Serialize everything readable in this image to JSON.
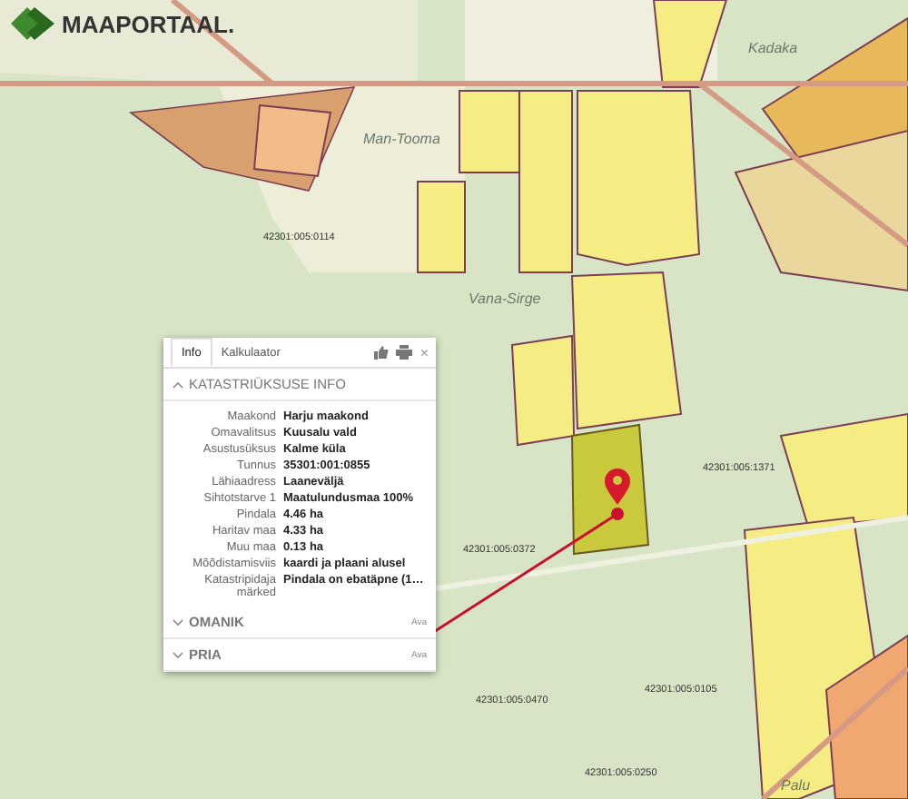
{
  "logo": {
    "text": "MAAPORTAAL."
  },
  "map": {
    "labels": [
      {
        "kind": "place",
        "text": "Kadaka"
      },
      {
        "kind": "place",
        "text": "Vana-Sirge"
      },
      {
        "kind": "place",
        "text": "Man-Tooma"
      },
      {
        "kind": "place",
        "text": "Palu"
      },
      {
        "kind": "parcel",
        "text": "42301:005:0470"
      },
      {
        "kind": "parcel",
        "text": "42301:005:0105"
      },
      {
        "kind": "parcel",
        "text": "42301:005:1371"
      },
      {
        "kind": "parcel",
        "text": "42301:005:0114"
      },
      {
        "kind": "parcel",
        "text": "42301:005:0250"
      },
      {
        "kind": "parcel",
        "text": "42301:005:0372"
      }
    ]
  },
  "popup": {
    "close": "×",
    "tabs": [
      {
        "label": "Info",
        "selected": true
      },
      {
        "label": "Kalkulaator",
        "selected": false
      }
    ],
    "sections": [
      {
        "title": "KATASTRIÜKSUSE INFO",
        "expanded": true,
        "rows": [
          {
            "label": "Maakond",
            "value": "Harju maakond"
          },
          {
            "label": "Omavalitsus",
            "value": "Kuusalu vald"
          },
          {
            "label": "Asustusüksus",
            "value": "Kalme küla"
          },
          {
            "label": "Tunnus",
            "value": "35301:001:0855"
          },
          {
            "label": "Lähiaadress",
            "value": "Laaneväljä"
          },
          {
            "label": "Sihtotstarve 1",
            "value": "Maatulundusmaa 100%"
          },
          {
            "label": "Pindala",
            "value": "4.46 ha"
          },
          {
            "label": "Haritav maa",
            "value": "4.33 ha"
          },
          {
            "label": "Muu maa",
            "value": "0.13 ha"
          },
          {
            "label": "Mõõdistamisviis",
            "value": "kaardi ja plaani alusel"
          },
          {
            "label": "Katastripidaja märked",
            "value": "Pindala on ebatäpne (1…"
          }
        ]
      },
      {
        "title": "OMANIK",
        "expanded": false,
        "action": "Ava"
      },
      {
        "title": "PRIA",
        "expanded": false,
        "action": "Ava"
      }
    ]
  }
}
